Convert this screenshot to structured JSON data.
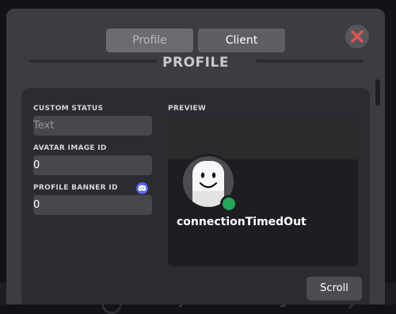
{
  "background": {
    "message_placeholder": "Send your first message"
  },
  "tabs": [
    {
      "label": "Profile",
      "active": false
    },
    {
      "label": "Client",
      "active": true
    }
  ],
  "heading": "PROFILE",
  "fields": {
    "custom_status": {
      "label": "CUSTOM STATUS",
      "value": "",
      "placeholder": "Text"
    },
    "avatar_image_id": {
      "label": "AVATAR IMAGE ID",
      "value": "0"
    },
    "profile_banner_id": {
      "label": "PROFILE BANNER ID",
      "value": "0"
    }
  },
  "preview": {
    "label": "PREVIEW",
    "username": "connectionTimedOut",
    "status_color": "#23a55a"
  },
  "scroll_button": {
    "label": "Scroll"
  },
  "icons": {
    "close": "close-x-icon",
    "discord": "discord-icon",
    "avatar": "smiley-face-avatar"
  },
  "colors": {
    "accent_close": "#e25555",
    "discord_blue": "#5865f2",
    "online_green": "#23a55a"
  }
}
